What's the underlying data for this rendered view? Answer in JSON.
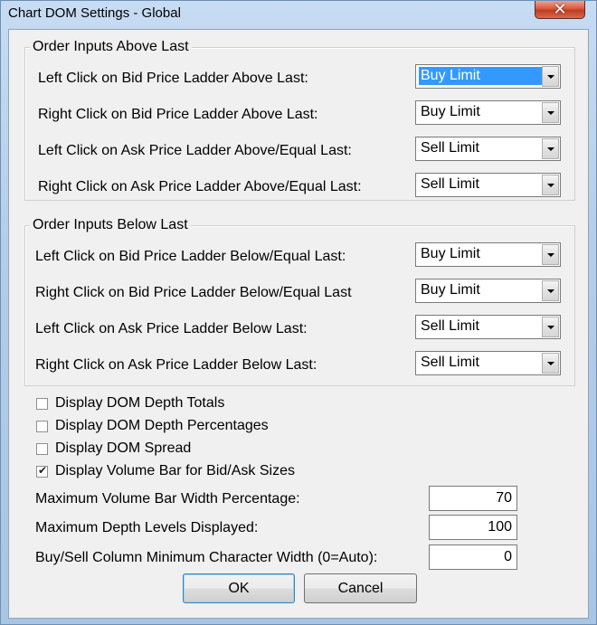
{
  "window": {
    "title": "Chart DOM Settings - Global",
    "close_glyph": "✕"
  },
  "above_group": {
    "title": "Order Inputs Above Last",
    "rows": [
      {
        "label": "Left Click on Bid Price Ladder Above Last:",
        "value": "Buy Limit"
      },
      {
        "label": "Right Click on Bid Price Ladder Above Last:",
        "value": "Buy Limit"
      },
      {
        "label": "Left Click on Ask Price Ladder Above/Equal Last:",
        "value": "Sell Limit"
      },
      {
        "label": "Right Click on Ask Price Ladder Above/Equal Last:",
        "value": "Sell Limit"
      }
    ]
  },
  "below_group": {
    "title": "Order Inputs Below Last",
    "rows": [
      {
        "label": "Left Click on Bid Price Ladder Below/Equal Last:",
        "value": "Buy Limit"
      },
      {
        "label": "Right Click on Bid Price Ladder Below/Equal Last",
        "value": "Buy Limit"
      },
      {
        "label": "Left Click on Ask Price Ladder Below Last:",
        "value": "Sell Limit"
      },
      {
        "label": "Right Click on Ask Price Ladder Below Last:",
        "value": "Sell Limit"
      }
    ]
  },
  "checkboxes": [
    {
      "label": "Display DOM Depth Totals",
      "checked": false
    },
    {
      "label": "Display DOM Depth Percentages",
      "checked": false
    },
    {
      "label": "Display DOM Spread",
      "checked": false
    },
    {
      "label": "Display Volume Bar for Bid/Ask Sizes",
      "checked": true
    }
  ],
  "fields": [
    {
      "label": "Maximum Volume Bar Width Percentage:",
      "value": "70"
    },
    {
      "label": "Maximum Depth Levels Displayed:",
      "value": "100"
    },
    {
      "label": "Buy/Sell Column Minimum Character Width (0=Auto):",
      "value": "0"
    }
  ],
  "buttons": {
    "ok": "OK",
    "cancel": "Cancel"
  }
}
